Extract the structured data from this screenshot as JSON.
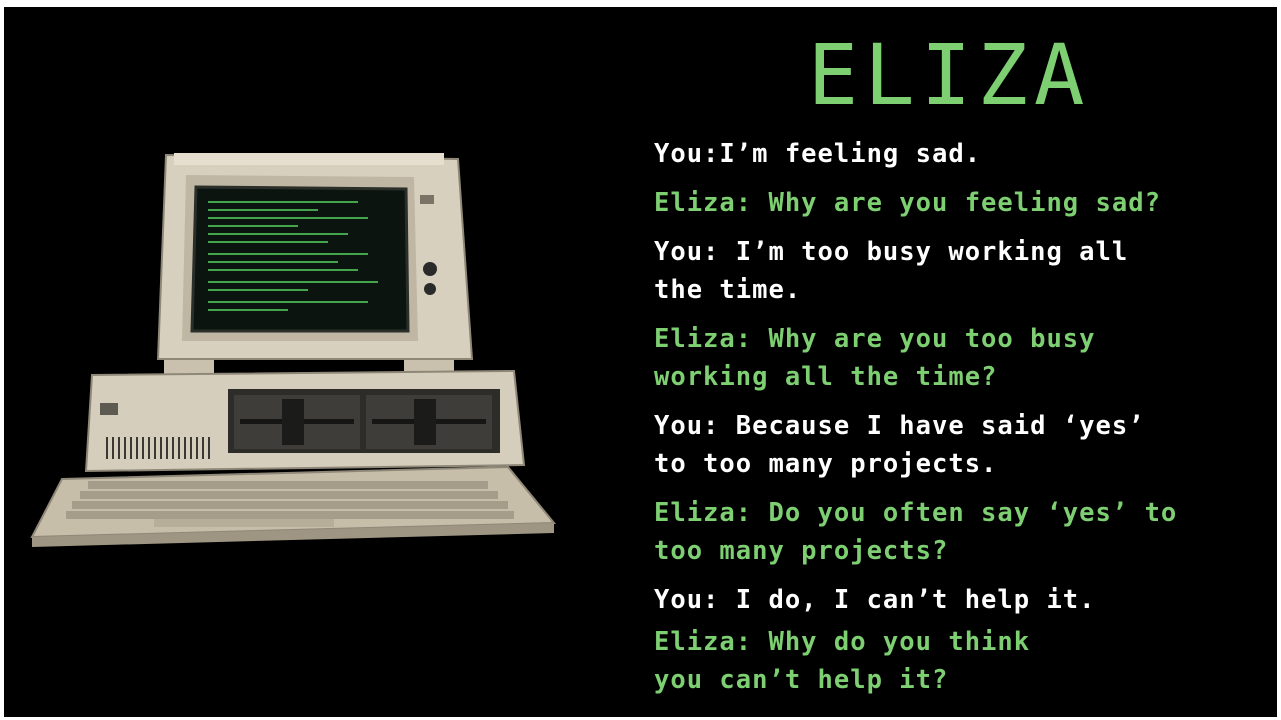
{
  "slide": {
    "title": "ELIZA",
    "colors": {
      "background": "#000000",
      "user_text": "#ffffff",
      "eliza_text": "#7dcf72"
    },
    "image": "ibm-pc-computer",
    "dialogue": [
      {
        "speaker": "you",
        "lines": [
          "You:I’m feeling sad."
        ]
      },
      {
        "speaker": "eliza",
        "lines": [
          "Eliza: Why are you feeling sad?"
        ]
      },
      {
        "speaker": "you",
        "lines": [
          "You: I’m too busy working all",
          "the time."
        ]
      },
      {
        "speaker": "eliza",
        "lines": [
          "Eliza: Why are you too busy",
          "working all the time?"
        ]
      },
      {
        "speaker": "you",
        "lines": [
          "You: Because I have said ‘yes’",
          "to too many projects."
        ]
      },
      {
        "speaker": "eliza",
        "lines": [
          "Eliza: Do you often say ‘yes’ to",
          "too many projects?"
        ]
      },
      {
        "speaker": "you",
        "lines": [
          "You: I do, I can’t help it."
        ]
      },
      {
        "speaker": "eliza",
        "lines": [
          "Eliza: Why do you think",
          "you can’t help it?"
        ]
      }
    ]
  }
}
